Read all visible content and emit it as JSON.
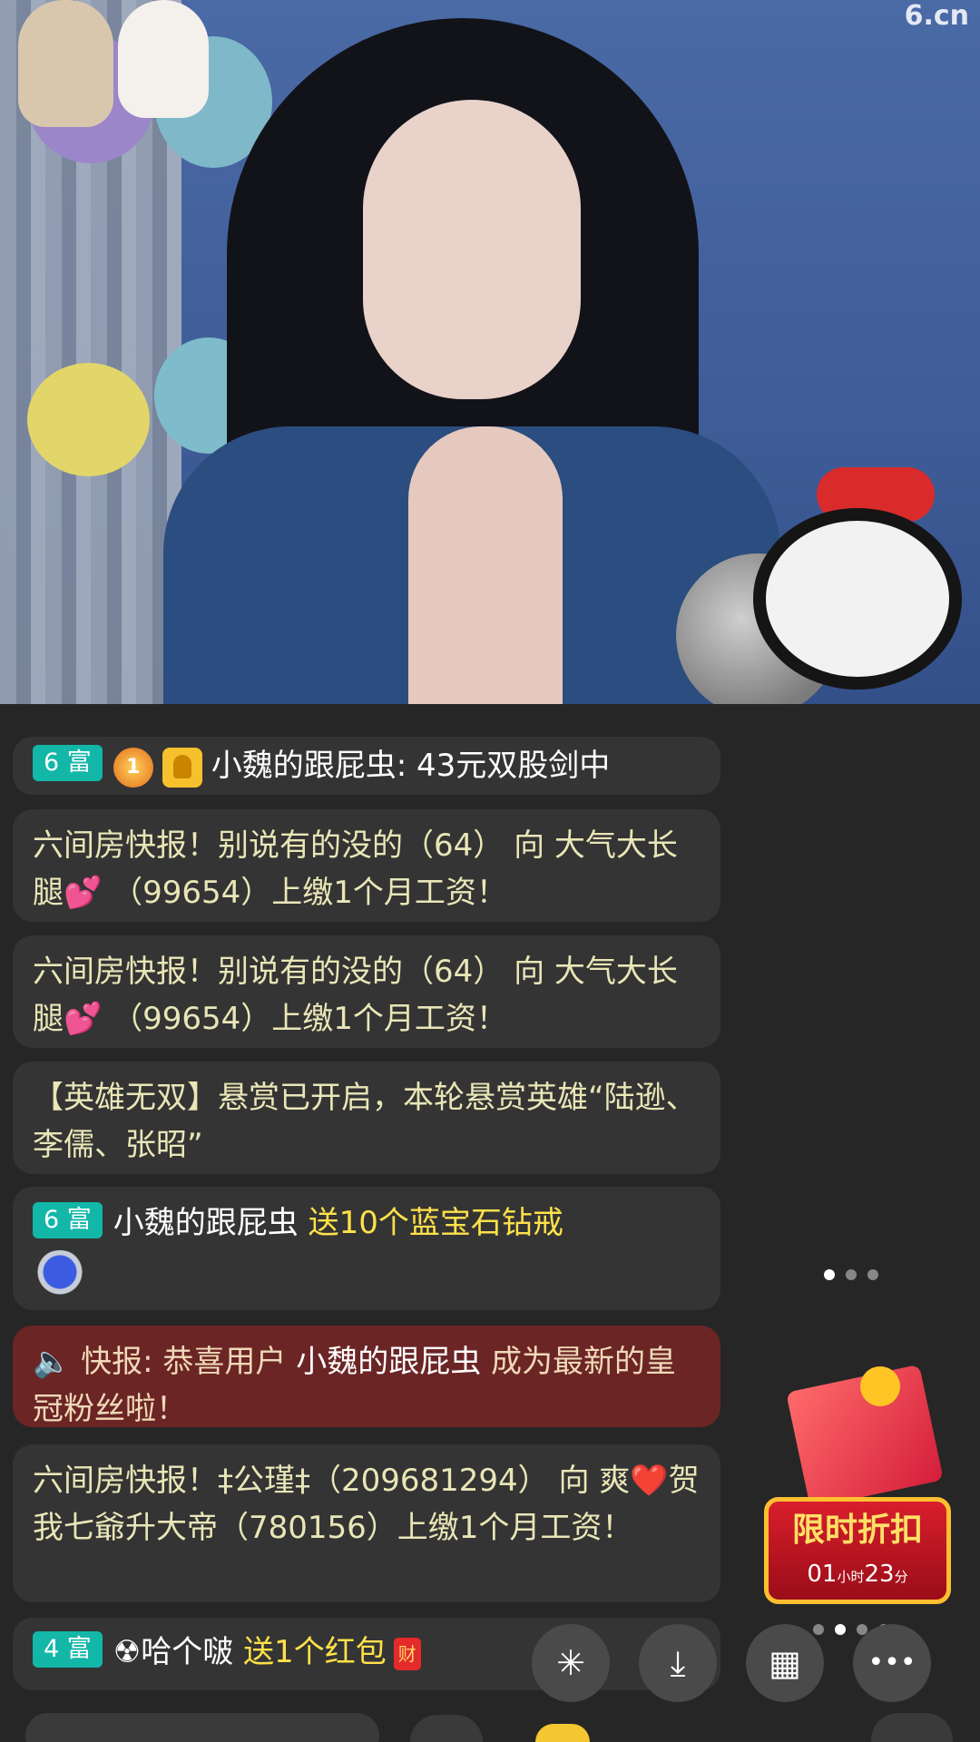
{
  "video": {
    "watermark": "6.cn"
  },
  "chat": {
    "messages": [
      {
        "level": "6 富",
        "medal": "1",
        "user": "小魏的跟屁虫",
        "text": ": 43元双股剑中"
      },
      {
        "text1": "六间房快报！别说有的没的（64） 向 大气大长腿💕 （99654）上缴1个月工资！"
      },
      {
        "text1": "六间房快报！别说有的没的（64） 向 大气大长腿💕 （99654）上缴1个月工资！"
      },
      {
        "text1": "【英雄无双】悬赏已开启，本轮悬赏英雄“陆逊、李儒、张昭”"
      },
      {
        "level": "6 富",
        "user": "小魏的跟屁虫",
        "gift": "送10个蓝宝石钻戒"
      },
      {
        "icon": "🔈",
        "prefix": "快报: 恭喜用户",
        "user": "小魏的跟屁虫",
        "suffix": "成为最新的皇冠粉丝啦！"
      },
      {
        "text1": "六间房快报！‡公瑾‡（209681294） 向 爽❤️贺我七爺升大帝（780156）上缴1个月工资！"
      },
      {
        "level": "4 富",
        "user": "☢哈个啵",
        "gift": "送1个红包",
        "redpack": "财"
      }
    ]
  },
  "promo": {
    "title": "限时折扣",
    "hours": "01",
    "hours_unit": "小时",
    "minutes": "23",
    "minutes_unit": "分"
  },
  "actions": {
    "fab1": "✳",
    "fab2": "⤓",
    "fab3": "▦",
    "fab4": "•••"
  }
}
